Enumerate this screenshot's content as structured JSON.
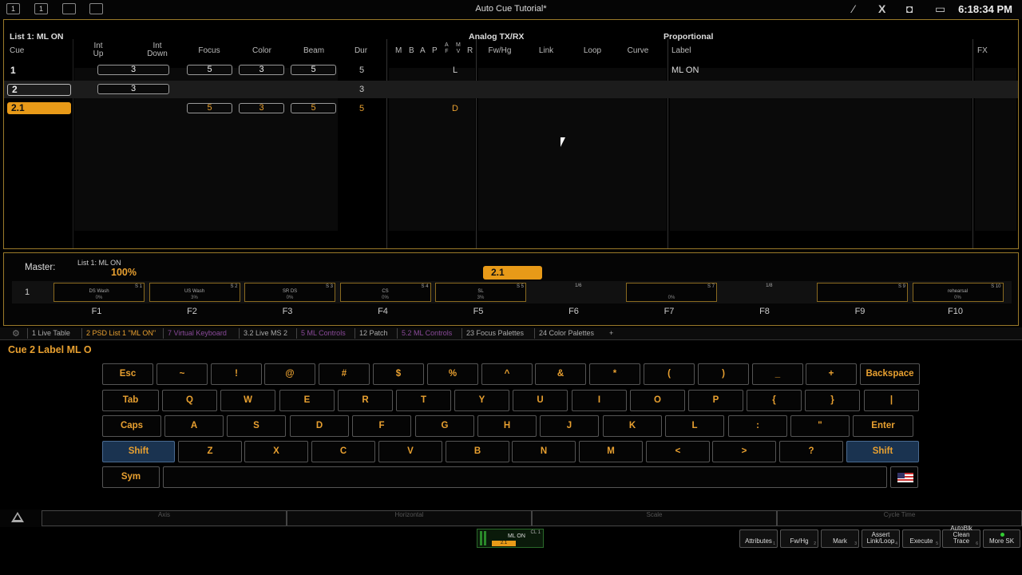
{
  "topbar": {
    "icon1": "1",
    "icon2": "1",
    "title": "Auto Cue Tutorial*",
    "clock": "6:18:34 PM"
  },
  "cuelist": {
    "list_label": "List 1: ML ON",
    "group_analog": "Analog TX/RX",
    "group_proportional": "Proportional",
    "headers": {
      "cue": "Cue",
      "int_up_1": "Int",
      "int_up_2": "Up",
      "int_down_1": "Int",
      "int_down_2": "Down",
      "focus": "Focus",
      "color": "Color",
      "beam": "Beam",
      "dur": "Dur",
      "m": "M",
      "b": "B",
      "a": "A",
      "p": "P",
      "af_1": "A",
      "af_2": "F",
      "mv_1": "M",
      "mv_2": "V",
      "r": "R",
      "fwhg": "Fw/Hg",
      "link": "Link",
      "loop": "Loop",
      "curve": "Curve",
      "label": "Label",
      "fx": "FX"
    },
    "rows": [
      {
        "cue": "1",
        "int": "3",
        "focus": "5",
        "color": "3",
        "beam": "5",
        "dur": "5",
        "flag": "L",
        "label": "ML ON"
      },
      {
        "cue": "2",
        "int": "3",
        "dur": "3"
      },
      {
        "cue": "2.1",
        "focus": "5",
        "color": "3",
        "beam": "5",
        "dur": "5",
        "flag": "D"
      }
    ]
  },
  "master": {
    "label": "Master:",
    "list": "List 1: ML ON",
    "percent": "100%",
    "pending_cue": "2.1",
    "page": "1",
    "faders": [
      {
        "name": "DS Wash",
        "pct": "0%",
        "slot": "S 1"
      },
      {
        "name": "US Wash",
        "pct": "3%",
        "slot": "S 2"
      },
      {
        "name": "SR DS",
        "pct": "0%",
        "slot": "S 3"
      },
      {
        "name": "CS",
        "pct": "0%",
        "slot": "S 4"
      },
      {
        "name": "SL",
        "pct": "3%",
        "slot": "S 5"
      },
      {
        "name": "",
        "pct": "",
        "slot": "1/6"
      },
      {
        "name": "",
        "pct": "0%",
        "slot": "S 7"
      },
      {
        "name": "",
        "pct": "",
        "slot": "1/8"
      },
      {
        "name": "",
        "pct": "",
        "slot": "S 9"
      },
      {
        "name": "rehearsal",
        "pct": "0%",
        "slot": "S 10"
      }
    ],
    "fkeys": [
      "F1",
      "F2",
      "F3",
      "F4",
      "F5",
      "F6",
      "F7",
      "F8",
      "F9",
      "F10"
    ]
  },
  "tabs": [
    {
      "label": "1 Live Table",
      "color": "#aaaaaa"
    },
    {
      "label": "2 PSD List 1 \"ML ON\"",
      "color": "#e8a030"
    },
    {
      "label": "7 Virtual Keyboard",
      "color": "#8a4a9a"
    },
    {
      "label": "3.2 Live MS 2",
      "color": "#aaaaaa"
    },
    {
      "label": "5 ML Controls",
      "color": "#8a4a9a"
    },
    {
      "label": "12 Patch",
      "color": "#aaaaaa"
    },
    {
      "label": "5.2 ML Controls",
      "color": "#8a4a9a"
    },
    {
      "label": "23 Focus Palettes",
      "color": "#aaaaaa"
    },
    {
      "label": "24 Color Palettes",
      "color": "#aaaaaa"
    },
    {
      "label": "+",
      "color": "#aaaaaa"
    }
  ],
  "command_line": "Cue 2 Label ML O",
  "keyboard": {
    "row1": [
      "Esc",
      "~",
      "!",
      "@",
      "#",
      "$",
      "%",
      "^",
      "&",
      "*",
      "(",
      ")",
      "_",
      "+",
      "Backspace"
    ],
    "row2": [
      "Tab",
      "Q",
      "W",
      "E",
      "R",
      "T",
      "Y",
      "U",
      "I",
      "O",
      "P",
      "{",
      "}",
      "|"
    ],
    "row3": [
      "Caps",
      "A",
      "S",
      "D",
      "F",
      "G",
      "H",
      "J",
      "K",
      "L",
      ":",
      "\"",
      "Enter"
    ],
    "row4": [
      "Shift",
      "Z",
      "X",
      "C",
      "V",
      "B",
      "N",
      "M",
      "<",
      ">",
      "?",
      "Shift"
    ],
    "sym": "Sym",
    "text_value": ""
  },
  "encoders": [
    "Axis",
    "Horizontal",
    "Scale",
    "Cycle Time"
  ],
  "status_mini": {
    "label": "ML ON",
    "cue": "2.1",
    "list": "CL 1"
  },
  "softkeys": [
    {
      "label": "Attributes",
      "num": "1"
    },
    {
      "label": "Fw/Hg",
      "num": "2"
    },
    {
      "label": "Mark",
      "num": "3"
    },
    {
      "label": "Assert Link/Loop",
      "num": "4"
    },
    {
      "label": "Execute",
      "num": "5"
    },
    {
      "label": "AutoBlk Clean Trace",
      "num": "6"
    },
    {
      "label": "More SK",
      "num": ""
    }
  ],
  "colors": {
    "accent": "#e8a030",
    "border": "#9a7a2a",
    "shift_key": "#1a3350"
  }
}
